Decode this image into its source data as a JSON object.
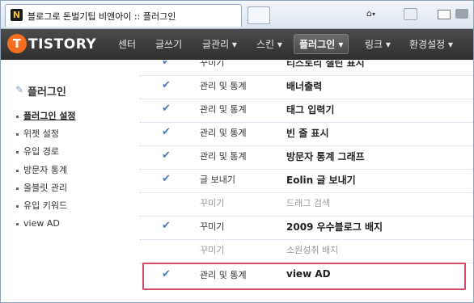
{
  "browser": {
    "tab_title": "블로그로 돈벌기팁 비앤아이 :: 플러그인",
    "favicon_letter": "N",
    "home_icon": "⌂",
    "caret": "▾"
  },
  "nav": {
    "logo_mark": "T",
    "logo_text": "TISTORY",
    "items": [
      {
        "label": "센터"
      },
      {
        "label": "글쓰기"
      },
      {
        "label": "글관리 ▾"
      },
      {
        "label": "스킨 ▾"
      },
      {
        "label": "플러그인 ▾"
      },
      {
        "label": "링크 ▾"
      },
      {
        "label": "환경설정 ▾"
      }
    ]
  },
  "sidebar": {
    "title": "플러그인",
    "pencil_icon": "✎",
    "items": [
      {
        "label": "플러그인 설정"
      },
      {
        "label": "위젯 설정"
      },
      {
        "label": "유입 경로"
      },
      {
        "label": "방문자 통계"
      },
      {
        "label": "올블릿 관리"
      },
      {
        "label": "유입 키워드"
      },
      {
        "label": "view AD"
      }
    ]
  },
  "plugins": {
    "check": "✔",
    "rows": [
      {
        "category": "꾸미기",
        "name": "티스토리 챌린 표시"
      },
      {
        "category": "관리 및 통계",
        "name": "배너출력"
      },
      {
        "category": "관리 및 통계",
        "name": "태그 입력기"
      },
      {
        "category": "관리 및 통계",
        "name": "빈 줄 표시"
      },
      {
        "category": "관리 및 통계",
        "name": "방문자 통계 그래프"
      },
      {
        "category": "글 보내기",
        "name": "Eolin 글 보내기"
      },
      {
        "category": "꾸미기",
        "name": "드래그 검색"
      },
      {
        "category": "꾸미기",
        "name": "2009 우수블로그 배지"
      },
      {
        "category": "꾸미기",
        "name": "소원성취 배지"
      },
      {
        "category": "관리 및 통계",
        "name": "view AD"
      }
    ]
  }
}
